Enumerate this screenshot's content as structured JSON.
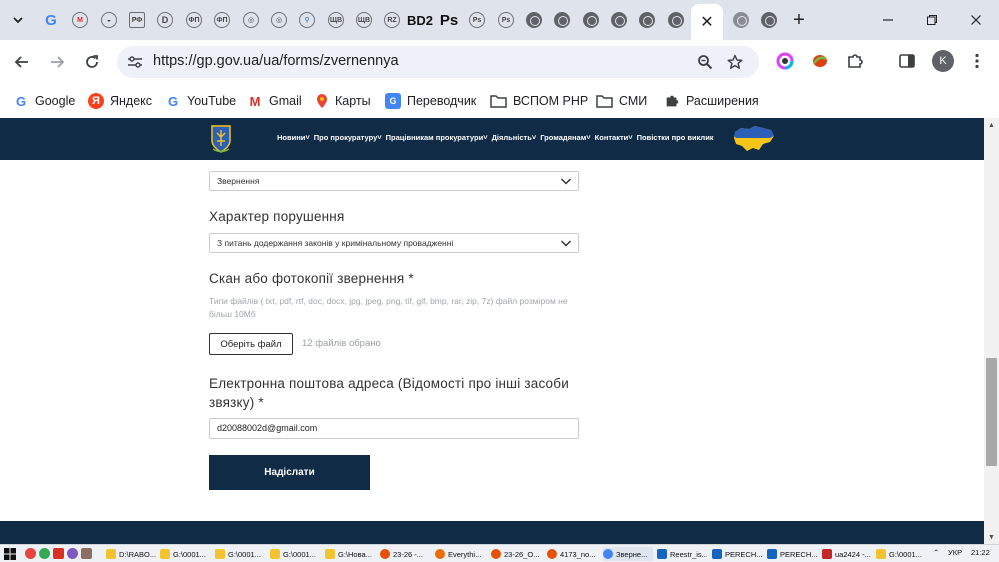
{
  "browser": {
    "tabs": {
      "favicons": [
        "google-icon",
        "gmail-icon",
        "site-icon",
        "russia-icon",
        "d-icon",
        "site-icon",
        "site-icon",
        "site-icon",
        "site-icon",
        "site-icon",
        "site-icon",
        "site-icon",
        "site-icon"
      ],
      "text_favicons": [
        "BD2",
        "Ps"
      ],
      "active_tab_close": "✕",
      "new_tab": "+"
    },
    "address": {
      "url": "https://gp.gov.ua/ua/forms/zvernennya"
    },
    "avatar_letter": "K",
    "bookmarks": [
      {
        "label": "Google",
        "icon": "google-icon"
      },
      {
        "label": "Яндекс",
        "icon": "yandex-icon"
      },
      {
        "label": "YouTube",
        "icon": "google-icon"
      },
      {
        "label": "Gmail",
        "icon": "gmail-icon"
      },
      {
        "label": "Карты",
        "icon": "maps-pin-icon"
      },
      {
        "label": "Переводчик",
        "icon": "translate-icon"
      },
      {
        "label": "ВСПОМ РНР",
        "icon": "folder-icon"
      },
      {
        "label": "СМИ",
        "icon": "folder-icon"
      },
      {
        "label": "Расширения",
        "icon": "puzzle-icon"
      }
    ]
  },
  "site": {
    "nav": [
      "Новини",
      "Про прокуратуру",
      "Працівникам прокуратури",
      "Діяльність",
      "Громадянам",
      "Контакти",
      "Повістки про виклик"
    ],
    "colors": {
      "header": "#0f2b45",
      "accent": "#f5c518",
      "ua_blue": "#2b5fb8"
    }
  },
  "form": {
    "type_select_value": "Звернення",
    "violation_label": "Характер порушення",
    "violation_value": "З питань додержання законів у кримінальному провадженні",
    "scan_label": "Скан або фотокопії звернення *",
    "scan_hint": "Типи файлів ( txt, pdf, rtf, doc, docx, jpg, jpeg, png, tif, gif, bmp, rar, zip, 7z) файл розміром не більш 10Мб",
    "file_button": "Оберіть файл",
    "file_status": "12 файлів обрано",
    "email_label": "Електронна поштова адреса (Відомості про інші засоби звязку) *",
    "email_value": "d20088002d@gmail.com",
    "submit": "Надіслати"
  },
  "taskbar": {
    "items": [
      "D:\\RABO...",
      "G:\\0001...",
      "G:\\0001...",
      "G:\\0001...",
      "G:\\Нова...",
      "23-26 -...",
      "Everythi...",
      "23-26_O...",
      "4173_no...",
      "Зверне...",
      "Reestr_is...",
      "PERECH...",
      "PERECH...",
      "ua2424 -...",
      "G:\\0001..."
    ],
    "lang": "УКР",
    "time": "21:22"
  }
}
